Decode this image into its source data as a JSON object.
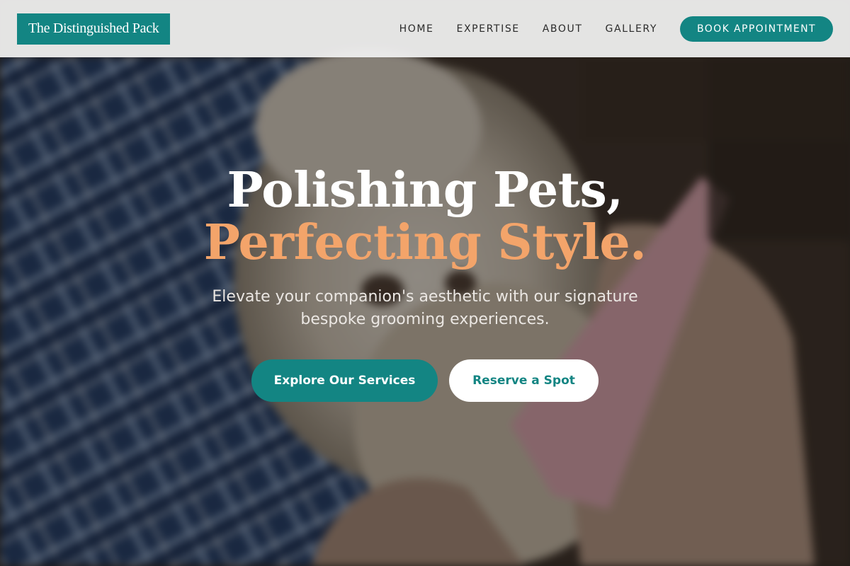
{
  "brand": {
    "name": "The Distinguished Pack"
  },
  "nav": {
    "items": [
      {
        "label": "HOME"
      },
      {
        "label": "EXPERTISE"
      },
      {
        "label": "ABOUT"
      },
      {
        "label": "GALLERY"
      }
    ],
    "cta_label": "BOOK APPOINTMENT"
  },
  "hero": {
    "headline_line1": "Polishing Pets,",
    "headline_line2": "Perfecting Style.",
    "subtitle": "Elevate your companion's aesthetic with our signature bespoke grooming experiences.",
    "primary_cta": "Explore Our Services",
    "secondary_cta": "Reserve a Spot",
    "background_image": "blurred photo of a fluffy white dog wrapped in a blue plaid blanket being brushed with a pink comb"
  },
  "colors": {
    "brand_teal": "#138583",
    "accent_orange": "#f3a46a",
    "header_bg": "#f0f0f0"
  }
}
